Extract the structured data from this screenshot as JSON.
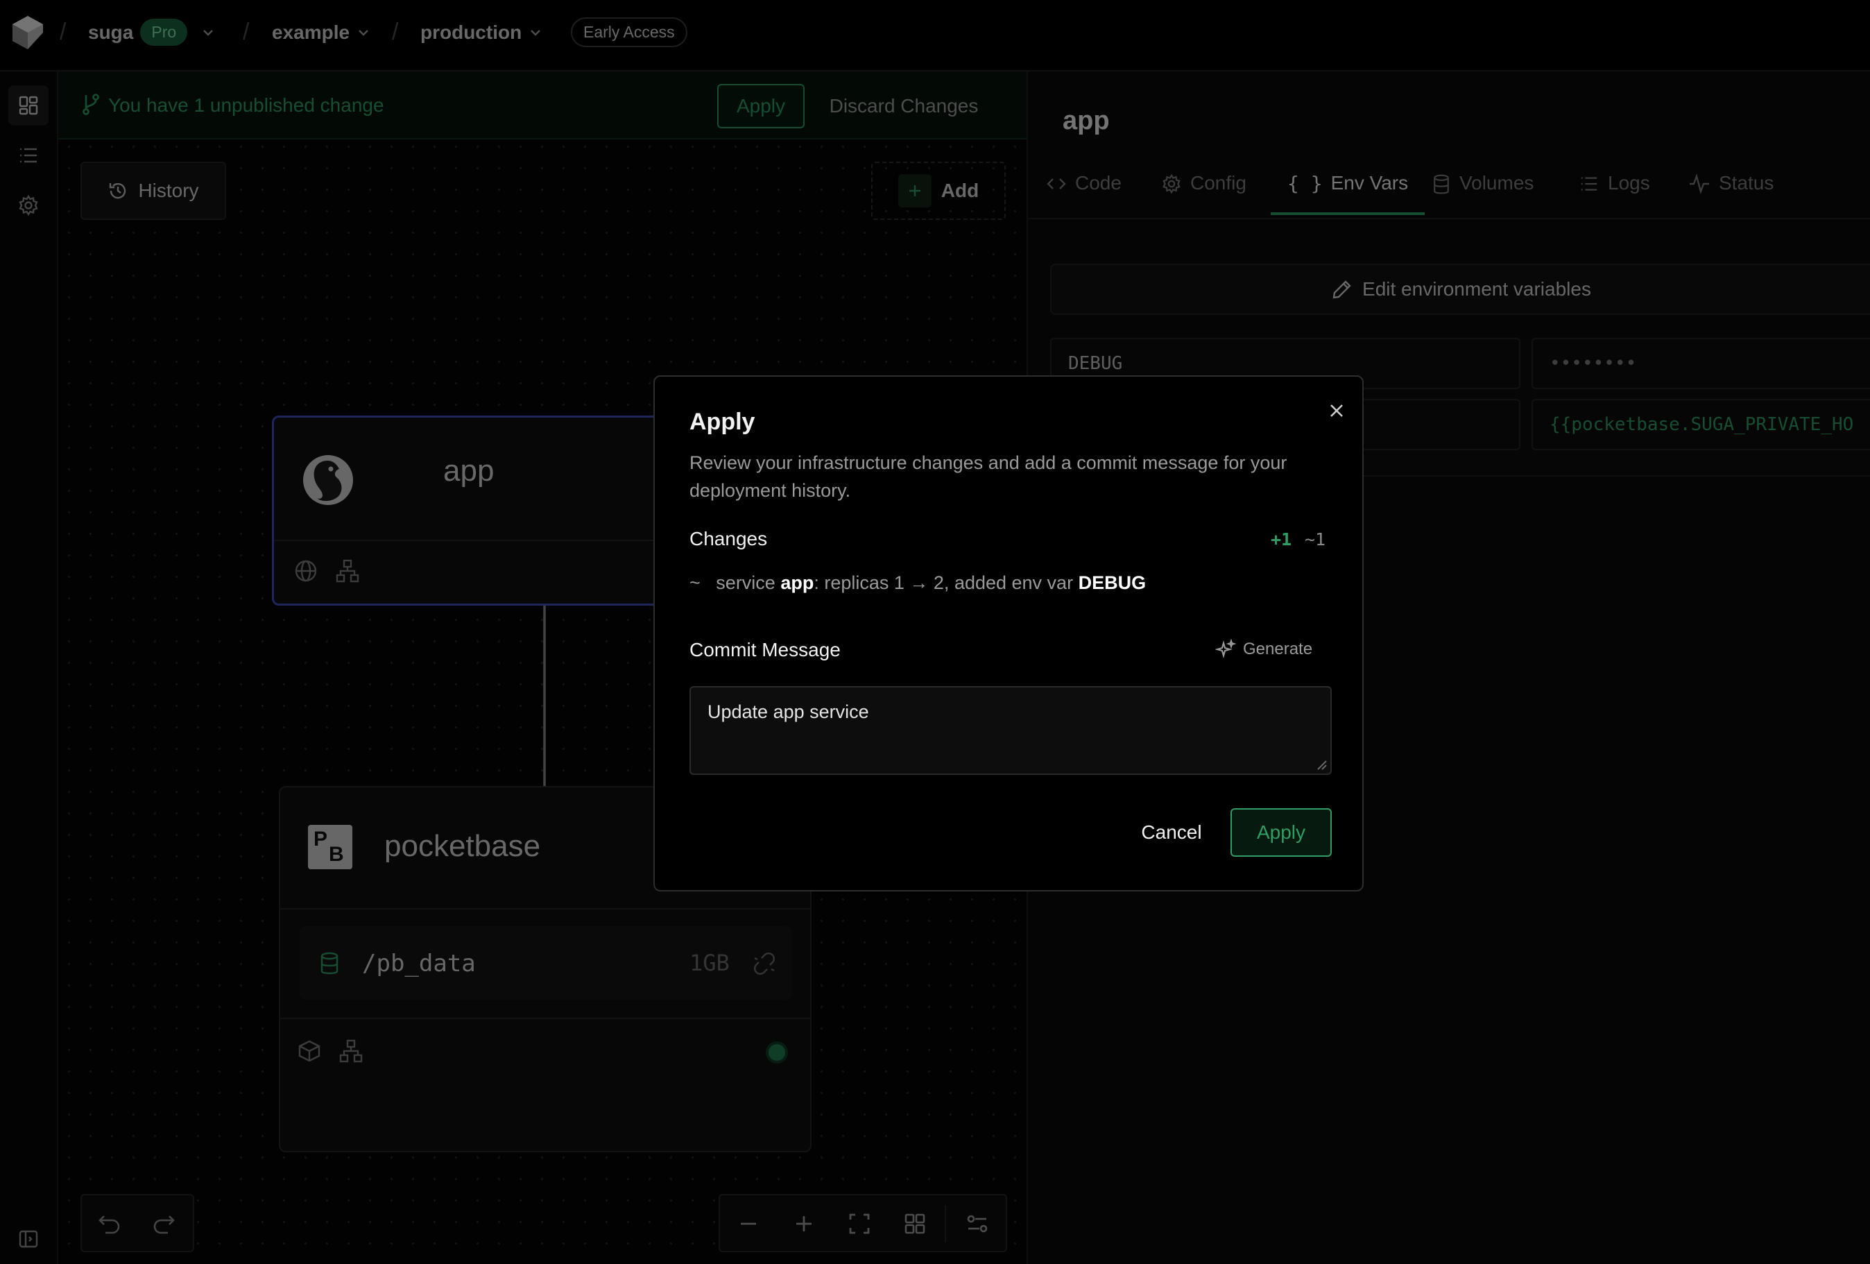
{
  "topbar": {
    "logo": "suga-logo",
    "breadcrumbs": [
      {
        "label": "suga",
        "badge": "Pro"
      },
      {
        "label": "example"
      },
      {
        "label": "production"
      }
    ],
    "early_access": "Early Access"
  },
  "leftrail": {
    "items": [
      {
        "icon": "dashboard-grid-icon",
        "active": true
      },
      {
        "icon": "list-icon"
      },
      {
        "icon": "gear-icon"
      }
    ],
    "bottom_icon": "sidebar-toggle-icon"
  },
  "banner": {
    "message": "You have 1 unpublished change",
    "apply_label": "Apply",
    "discard_label": "Discard Changes"
  },
  "canvas": {
    "history_label": "History",
    "add_label": "Add",
    "nodes": {
      "app": {
        "name": "app",
        "icon": "python-icon"
      },
      "pocketbase": {
        "name": "pocketbase",
        "icon": "pocketbase-logo",
        "volume": {
          "path": "/pb_data",
          "size": "1GB"
        },
        "status_color": "#1f7a4a"
      }
    }
  },
  "right_panel": {
    "title": "app",
    "tabs": [
      {
        "label": "Code",
        "icon": "code-icon"
      },
      {
        "label": "Config",
        "icon": "gear-icon"
      },
      {
        "label": "Env Vars",
        "icon": "braces-icon",
        "active": true
      },
      {
        "label": "Volumes",
        "icon": "database-icon"
      },
      {
        "label": "Logs",
        "icon": "list-icon"
      },
      {
        "label": "Status",
        "icon": "activity-icon"
      }
    ],
    "edit_env_label": "Edit environment variables",
    "env_vars": [
      {
        "key": "DEBUG",
        "value": "••••••••"
      },
      {
        "key": "",
        "value": "{{pocketbase.SUGA_PRIVATE_HO"
      }
    ]
  },
  "dialog": {
    "title": "Apply",
    "description": "Review your infrastructure changes and add a commit message for your deployment history.",
    "changes_label": "Changes",
    "added_count": "+1",
    "modified_count": "~1",
    "change": {
      "marker": "~",
      "prefix": "service",
      "service": "app",
      "middle": ": replicas 1 → 2, added env var",
      "var": "DEBUG"
    },
    "commit_label": "Commit Message",
    "generate_label": "Generate",
    "commit_value": "Update app service",
    "cancel_label": "Cancel",
    "apply_label": "Apply"
  },
  "colors": {
    "accent_green": "#2f9d64",
    "selection_blue": "#3b4fb8",
    "background": "#000000"
  }
}
